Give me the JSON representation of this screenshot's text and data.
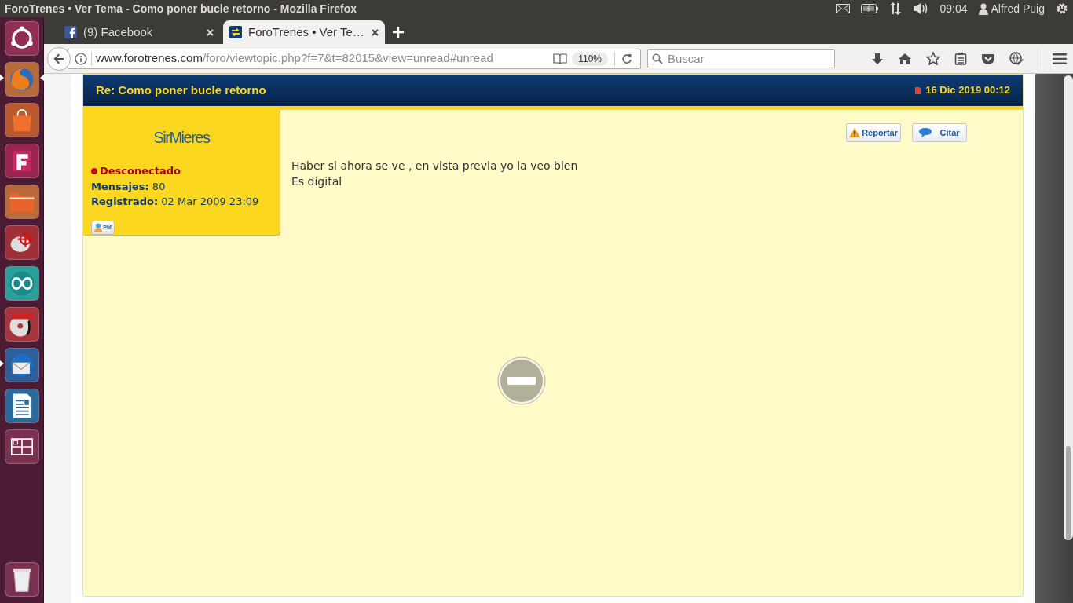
{
  "window": {
    "title": "ForoTrenes • Ver Tema - Como poner bucle retorno - Mozilla Firefox"
  },
  "panel": {
    "time": "09:04",
    "user": "Alfred Puig"
  },
  "launcher": [
    {
      "kind": "ubuntu",
      "running": false,
      "focused": false
    },
    {
      "kind": "firefox",
      "running": true,
      "focused": true
    },
    {
      "kind": "store",
      "running": false,
      "focused": false
    },
    {
      "kind": "letterf",
      "running": false,
      "focused": false
    },
    {
      "kind": "files",
      "running": false,
      "focused": false
    },
    {
      "kind": "target",
      "running": false,
      "focused": false
    },
    {
      "kind": "infinity",
      "running": false,
      "focused": false
    },
    {
      "kind": "disc",
      "running": false,
      "focused": false
    },
    {
      "kind": "mail",
      "running": true,
      "focused": false
    },
    {
      "kind": "writer",
      "running": false,
      "focused": false
    },
    {
      "kind": "workspaces",
      "running": false,
      "focused": false
    }
  ],
  "launcher_bottom": [
    {
      "kind": "trash",
      "running": false,
      "focused": false
    }
  ],
  "tabs": [
    {
      "label": "(9) Facebook",
      "kind": "facebook",
      "selected": false
    },
    {
      "label": "ForoTrenes • Ver Te…",
      "kind": "forum",
      "selected": true
    }
  ],
  "address": {
    "domain": "www.forotrenes.com",
    "path": "/foro/viewtopic.php?f=7&t=82015&view=unread#unread",
    "zoom": "110%"
  },
  "search": {
    "placeholder": "Buscar"
  },
  "post": {
    "title": "Re: Como poner bucle retorno",
    "date": "16 Dic 2019 00:12",
    "author": "SirMieres",
    "online": false,
    "status": "Desconectado",
    "stats": [
      {
        "label": "Mensajes:",
        "value": "80"
      },
      {
        "label": "Registrado:",
        "value": "02 Mar 2009 23:09"
      }
    ],
    "pm_label": "PM",
    "buttons": [
      {
        "label": "Reportar",
        "kind": "report"
      },
      {
        "label": "Citar",
        "kind": "quote"
      }
    ],
    "body": [
      "Haber si ahora se ve , en vista previa yo la veo bien",
      "Es digital"
    ],
    "plugin_blocked": true
  }
}
